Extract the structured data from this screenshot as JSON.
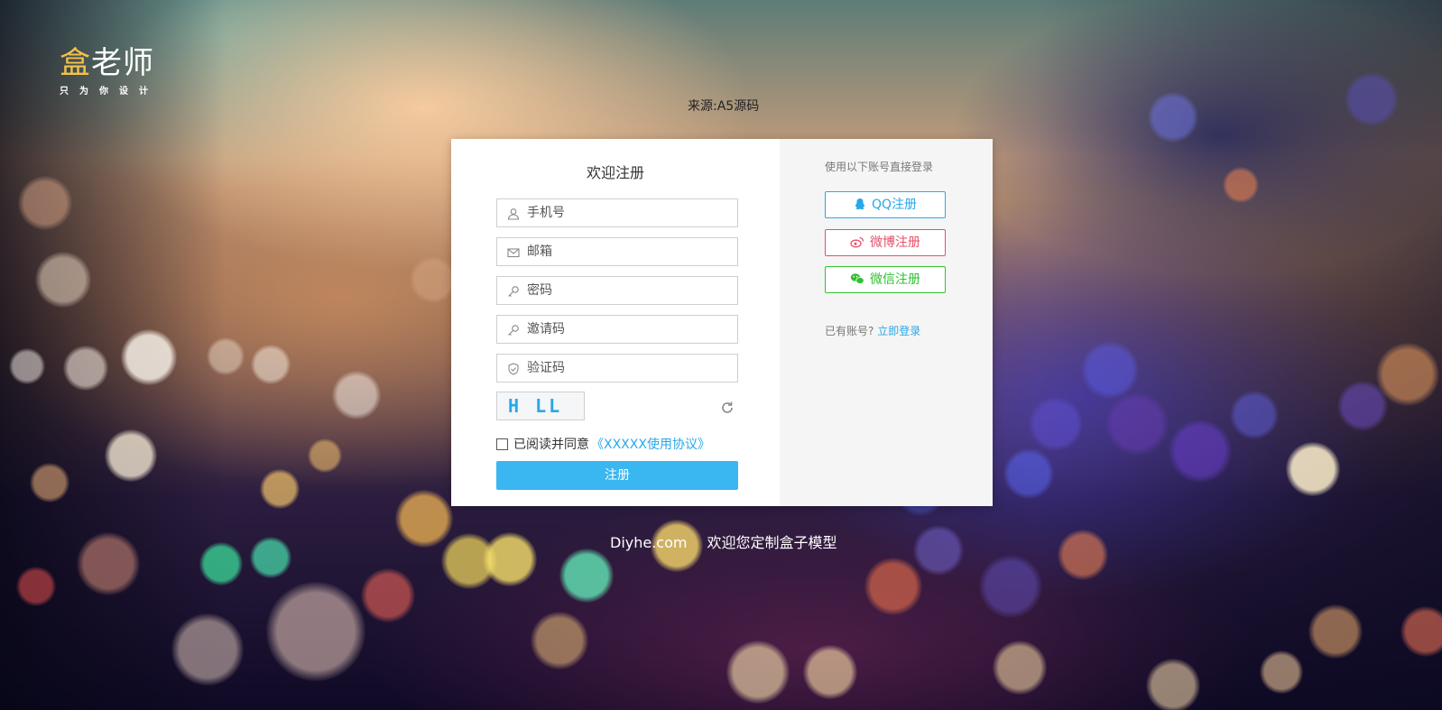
{
  "brand": {
    "name_first": "盒",
    "name_rest": "老师",
    "slogan": "只为你设计",
    "accent_color": "#f3c24a"
  },
  "source_note": "来源:A5源码",
  "register_form": {
    "title": "欢迎注册",
    "fields": [
      {
        "placeholder": "手机号",
        "icon": "user-icon",
        "value": ""
      },
      {
        "placeholder": "邮箱",
        "icon": "mail-icon",
        "value": ""
      },
      {
        "placeholder": "密码",
        "icon": "key-icon",
        "value": ""
      },
      {
        "placeholder": "邀请码",
        "icon": "key-icon",
        "value": ""
      },
      {
        "placeholder": "验证码",
        "icon": "shield-icon",
        "value": ""
      }
    ],
    "captcha_text": "H LL",
    "refresh_icon": "refresh-icon",
    "agreement_label": "已阅读并同意",
    "agreement_link": "《XXXXX使用协议》",
    "agreement_checked": false,
    "submit_label": "注册",
    "submit_color": "#3ab6f0"
  },
  "social_login": {
    "title": "使用以下账号直接登录",
    "buttons": [
      {
        "label": "QQ注册",
        "icon": "qq-icon",
        "color": "#2aa7e8"
      },
      {
        "label": "微博注册",
        "icon": "weibo-icon",
        "color": "#e94e6a"
      },
      {
        "label": "微信注册",
        "icon": "wechat-icon",
        "color": "#2fc22f"
      }
    ],
    "have_account_text": "已有账号?",
    "login_link": "立即登录"
  },
  "footer": {
    "site": "Diyhe.com",
    "tagline": "欢迎您定制盒子模型"
  }
}
